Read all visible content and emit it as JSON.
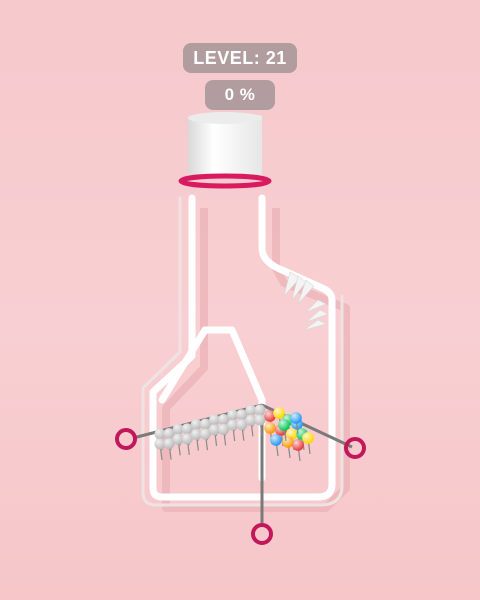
{
  "hud": {
    "level_text": "LEVEL: 21",
    "progress_text": "0 %"
  },
  "game": {
    "level": 21,
    "fill_progress": 0,
    "pins": [
      {
        "id": "pin-left",
        "label": ""
      },
      {
        "id": "pin-right",
        "label": ""
      },
      {
        "id": "pin-bottom",
        "label": ""
      }
    ],
    "colors": {
      "background": "#f7cbce",
      "container_wall": "#ffffff",
      "cup_rim": "#d81b60",
      "pin_ring": "#c2185b",
      "balls_gray": "#b9b9b9",
      "balls_colored": [
        "#e53935",
        "#ffd600",
        "#00c853",
        "#2196f3",
        "#ff9800"
      ]
    }
  }
}
